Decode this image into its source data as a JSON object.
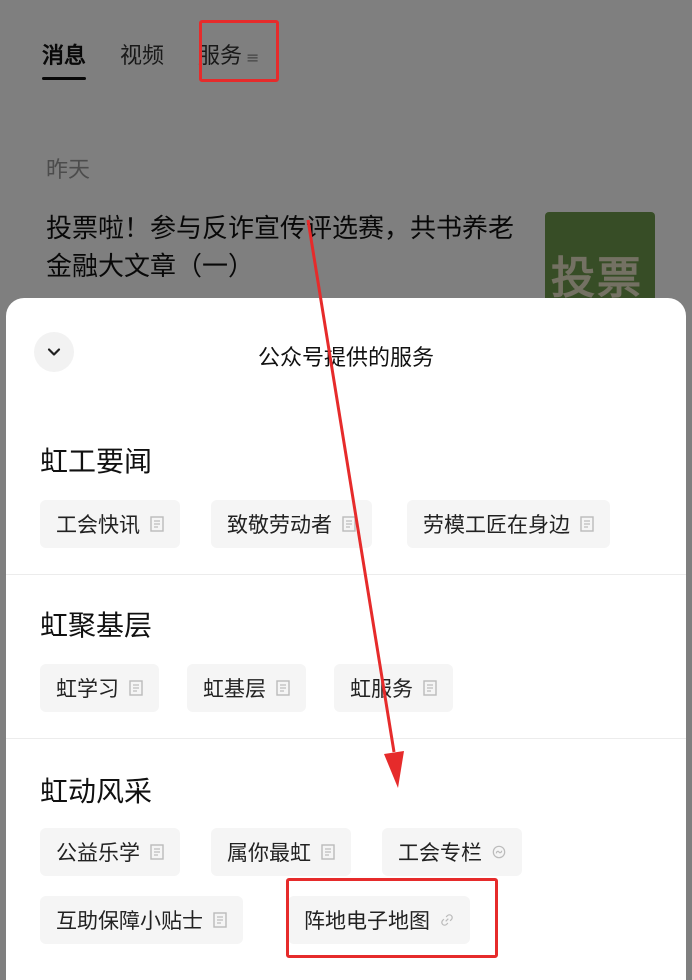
{
  "tabs": [
    {
      "label": "消息",
      "active": true
    },
    {
      "label": "视频",
      "active": false
    },
    {
      "label": "服务",
      "active": false,
      "icon": "menu-icon"
    }
  ],
  "feed": {
    "date": "昨天",
    "article_title": "投票啦！参与反诈宣传评选赛，共书养老金融大文章（一）",
    "thumb_text": "投票"
  },
  "sheet": {
    "title": "公众号提供的服务",
    "collapse_icon": "chevron-down-icon",
    "sections": [
      {
        "title": "虹工要闻",
        "items": [
          {
            "label": "工会快讯",
            "icon": "article-icon"
          },
          {
            "label": "致敬劳动者",
            "icon": "article-icon"
          },
          {
            "label": "劳模工匠在身边",
            "icon": "article-icon"
          }
        ]
      },
      {
        "title": "虹聚基层",
        "items": [
          {
            "label": "虹学习",
            "icon": "article-icon"
          },
          {
            "label": "虹基层",
            "icon": "article-icon"
          },
          {
            "label": "虹服务",
            "icon": "article-icon"
          }
        ]
      },
      {
        "title": "虹动风采",
        "items": [
          {
            "label": "公益乐学",
            "icon": "article-icon"
          },
          {
            "label": "属你最虹",
            "icon": "article-icon"
          },
          {
            "label": "工会专栏",
            "icon": "miniprogram-icon"
          },
          {
            "label": "互助保障小贴士",
            "icon": "article-icon"
          },
          {
            "label": "阵地电子地图",
            "icon": "link-icon"
          }
        ]
      }
    ]
  },
  "colors": {
    "highlight": "#e62b2b",
    "overlay": "rgba(0,0,0,0.5)"
  }
}
